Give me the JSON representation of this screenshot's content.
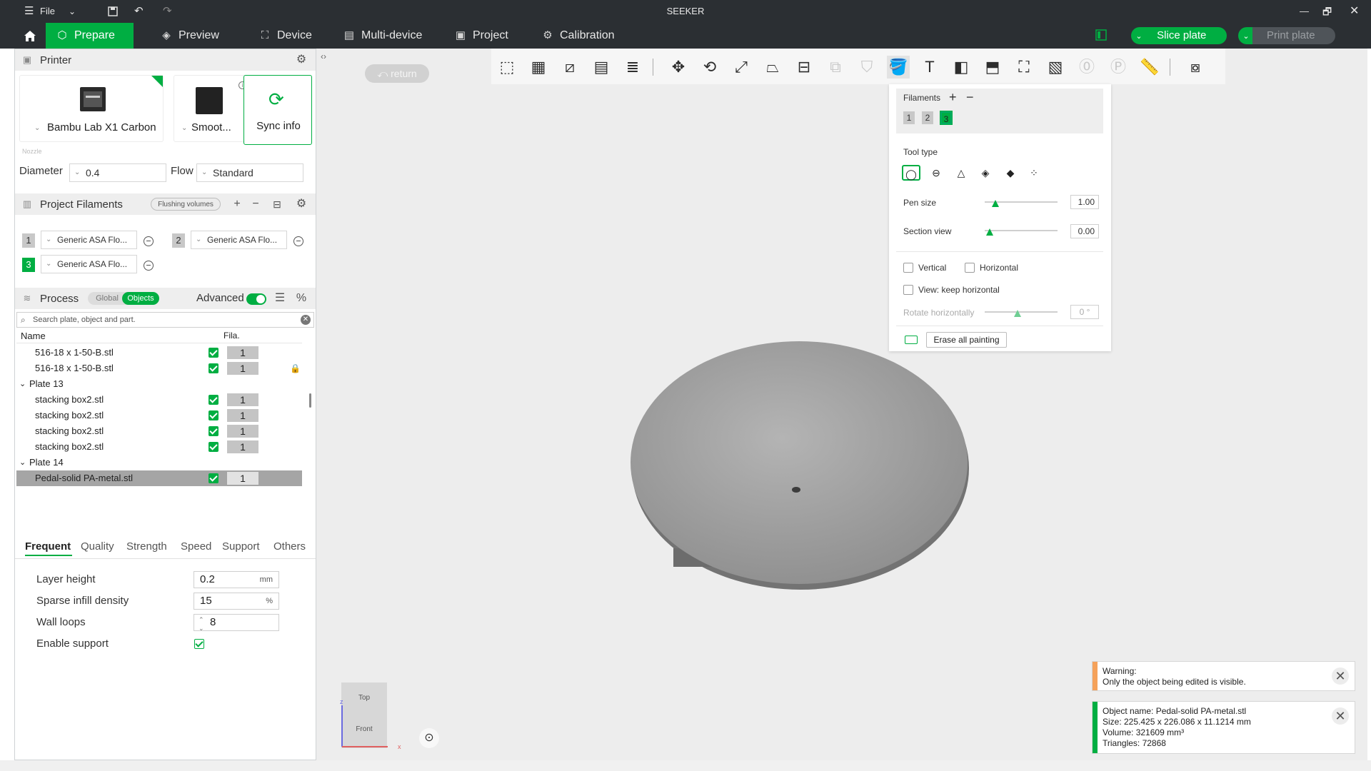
{
  "titlebar": {
    "file_label": "File",
    "app_title": "SEEKER",
    "menu_icon": "hamburger-icon",
    "controls": [
      "minimize-icon",
      "maximize-icon",
      "close-icon"
    ]
  },
  "navbar": {
    "tabs": [
      {
        "label": "Prepare",
        "icon": "cube-icon"
      },
      {
        "label": "Preview",
        "icon": "layers-icon"
      },
      {
        "label": "Device",
        "icon": "device-icon"
      },
      {
        "label": "Multi-device",
        "icon": "multi-device-icon"
      },
      {
        "label": "Project",
        "icon": "project-icon"
      },
      {
        "label": "Calibration",
        "icon": "calibration-icon"
      }
    ],
    "slice_label": "Slice plate",
    "print_label": "Print plate",
    "accent": "#00ae42"
  },
  "printer": {
    "title": "Printer",
    "model": "Bambu Lab X1 Carbon",
    "plate": "Smoot...",
    "sync_label": "Sync info",
    "nozzle_label": "Nozzle",
    "diameter_label": "Diameter",
    "diameter_value": "0.4",
    "flow_label": "Flow",
    "flow_value": "Standard"
  },
  "filaments": {
    "title": "Project Filaments",
    "flushing_label": "Flushing volumes",
    "items": [
      {
        "num": "1",
        "name": "Generic ASA Flo..."
      },
      {
        "num": "2",
        "name": "Generic ASA Flo..."
      },
      {
        "num": "3",
        "name": "Generic ASA Flo..."
      }
    ]
  },
  "process": {
    "title": "Process",
    "global_label": "Global",
    "objects_label": "Objects",
    "advanced_label": "Advanced",
    "search_placeholder": "Search plate, object and part.",
    "col_name": "Name",
    "col_fila": "Fila.",
    "rows": [
      {
        "name": "516-18 x 1-50-B.stl",
        "fila": "1"
      },
      {
        "name": "516-18 x 1-50-B.stl",
        "fila": "1"
      },
      {
        "name": "Plate 13"
      },
      {
        "name": "stacking box2.stl",
        "fila": "1"
      },
      {
        "name": "stacking box2.stl",
        "fila": "1"
      },
      {
        "name": "stacking box2.stl",
        "fila": "1"
      },
      {
        "name": "stacking box2.stl",
        "fila": "1"
      },
      {
        "name": "Plate 14"
      },
      {
        "name": "Pedal-solid PA-metal.stl",
        "fila": "1"
      }
    ]
  },
  "settings": {
    "tabs": [
      "Frequent",
      "Quality",
      "Strength",
      "Speed",
      "Support",
      "Others"
    ],
    "layer_height_label": "Layer height",
    "layer_height_value": "0.2",
    "layer_height_unit": "mm",
    "infill_label": "Sparse infill density",
    "infill_value": "15",
    "infill_unit": "%",
    "wall_label": "Wall loops",
    "wall_value": "8",
    "support_label": "Enable support",
    "support_enabled": true
  },
  "viewport": {
    "return_label": "return",
    "cube_top": "Top",
    "cube_front": "Front",
    "axis_x": "x",
    "axis_z": "z"
  },
  "paint": {
    "filaments_label": "Filaments",
    "filament_nums": [
      "1",
      "2",
      "3"
    ],
    "tool_type_label": "Tool type",
    "pen_size_label": "Pen size",
    "pen_size_value": "1.00",
    "section_view_label": "Section view",
    "section_view_value": "0.00",
    "vertical_label": "Vertical",
    "horizontal_label": "Horizontal",
    "keep_horizontal_label": "View: keep horizontal",
    "rotate_label": "Rotate horizontally",
    "rotate_value": "0 °",
    "erase_label": "Erase all painting"
  },
  "notices": {
    "warning_title": "Warning:",
    "warning_text": "Only the object being edited is visible.",
    "warning_color": "#f5a25b",
    "info_lines": [
      "Object name: Pedal-solid PA-metal.stl",
      "Size: 225.425 x 226.086 x 11.1214 mm",
      "Volume: 321609 mm³",
      "Triangles: 72868"
    ],
    "info_color": "#00ae42"
  }
}
